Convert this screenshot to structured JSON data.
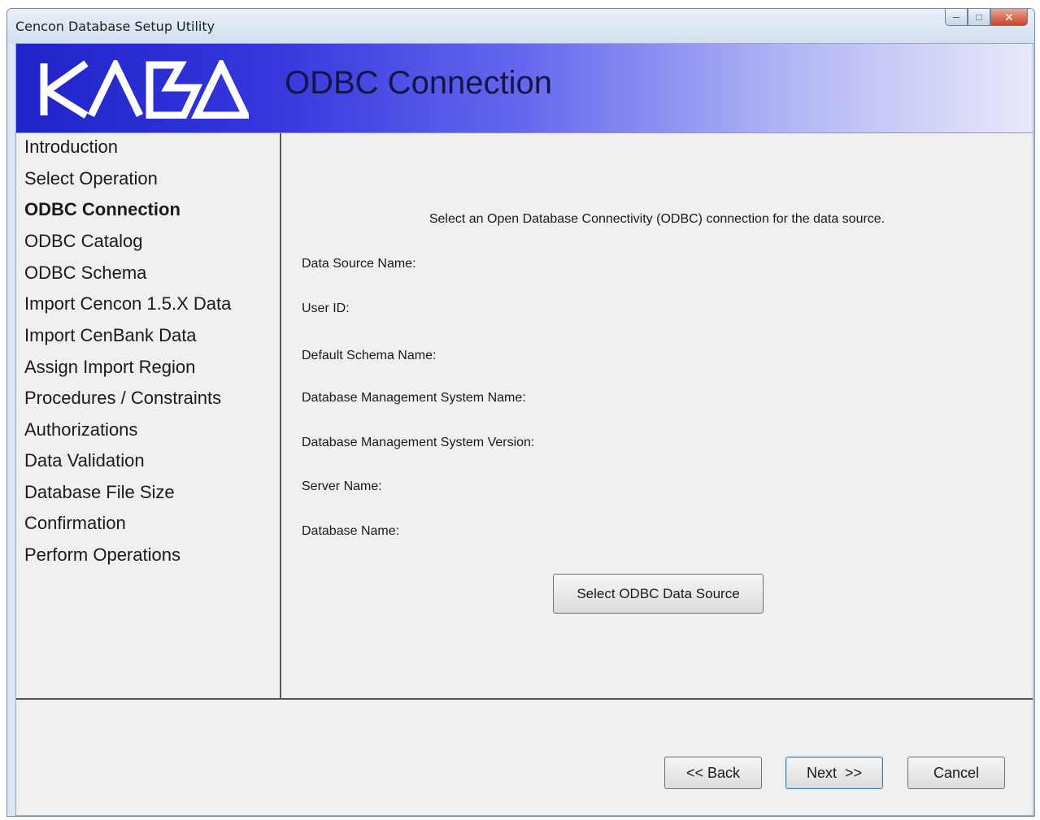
{
  "window": {
    "title": "Cencon Database Setup Utility",
    "controls": {
      "minimize_icon": "minimize-icon",
      "maximize_icon": "maximize-icon",
      "close_icon": "close-icon"
    }
  },
  "banner": {
    "logo_text": "KABA",
    "title": "ODBC Connection",
    "colors": {
      "gradient_start": "#1f23c9",
      "gradient_end": "#e8e9fa"
    }
  },
  "nav": {
    "items": [
      {
        "label": "Introduction",
        "active": false
      },
      {
        "label": "Select Operation",
        "active": false
      },
      {
        "label": "ODBC Connection",
        "active": true
      },
      {
        "label": "ODBC Catalog",
        "active": false
      },
      {
        "label": "ODBC Schema",
        "active": false
      },
      {
        "label": "Import Cencon 1.5.X Data",
        "active": false
      },
      {
        "label": "Import CenBank Data",
        "active": false
      },
      {
        "label": "Assign Import Region",
        "active": false
      },
      {
        "label": "Procedures / Constraints",
        "active": false
      },
      {
        "label": "Authorizations",
        "active": false
      },
      {
        "label": "Data Validation",
        "active": false
      },
      {
        "label": "Database File Size",
        "active": false
      },
      {
        "label": "Confirmation",
        "active": false
      },
      {
        "label": "Perform Operations",
        "active": false
      }
    ]
  },
  "content": {
    "intro": "Select an Open Database Connectivity (ODBC) connection for the data source.",
    "fields": [
      {
        "label": "Data Source Name:"
      },
      {
        "label": "User ID:"
      },
      {
        "label": "Default Schema Name:"
      },
      {
        "label": "Database Management System Name:"
      },
      {
        "label": "Database Management System Version:"
      },
      {
        "label": "Server Name:"
      },
      {
        "label": "Database Name:"
      }
    ],
    "select_button": "Select ODBC Data Source"
  },
  "footer": {
    "back": "<< Back",
    "next": ">>",
    "next_prefix": "Next",
    "cancel": "Cancel"
  }
}
